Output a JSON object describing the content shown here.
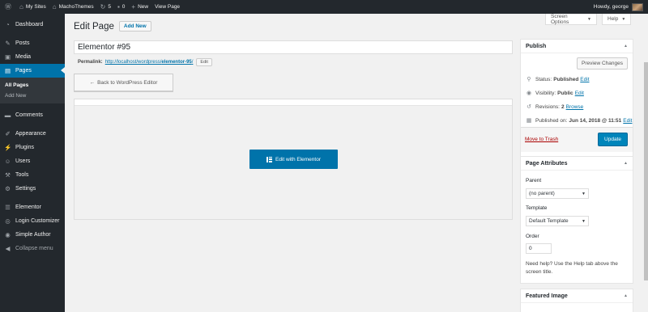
{
  "admin_bar": {
    "my_sites": "My Sites",
    "site_name": "MachoThemes",
    "updates_count": "5",
    "comments_count": "0",
    "new_label": "New",
    "view_page": "View Page",
    "howdy": "Howdy, george"
  },
  "sidebar": {
    "items": [
      {
        "label": "Dashboard",
        "icon": "dashboard-icon"
      },
      {
        "label": "Posts",
        "icon": "pin-icon"
      },
      {
        "label": "Media",
        "icon": "media-icon"
      },
      {
        "label": "Pages",
        "icon": "pages-icon"
      },
      {
        "label": "Comments",
        "icon": "comment-icon"
      },
      {
        "label": "Appearance",
        "icon": "brush-icon"
      },
      {
        "label": "Plugins",
        "icon": "plugin-icon"
      },
      {
        "label": "Users",
        "icon": "users-icon"
      },
      {
        "label": "Tools",
        "icon": "wrench-icon"
      },
      {
        "label": "Settings",
        "icon": "settings-icon"
      },
      {
        "label": "Elementor",
        "icon": "elementor-icon"
      },
      {
        "label": "Login Customizer",
        "icon": "login-icon"
      },
      {
        "label": "Simple Author",
        "icon": "author-icon"
      },
      {
        "label": "Collapse menu",
        "icon": "collapse-icon"
      }
    ],
    "submenu": {
      "all_pages": "All Pages",
      "add_new": "Add New"
    }
  },
  "screen_options": "Screen Options",
  "help": "Help",
  "page": {
    "heading": "Edit Page",
    "add_new": "Add New",
    "title_value": "Elementor #95",
    "permalink_label": "Permalink:",
    "permalink_base": "http://localhost/wordpress/",
    "permalink_slug": "elementor-95",
    "permalink_trail": "/",
    "permalink_edit": "Edit",
    "back_button": "Back to WordPress Editor",
    "elementor_button": "Edit with Elementor"
  },
  "publish": {
    "title": "Publish",
    "preview": "Preview Changes",
    "status_label": "Status:",
    "status_value": "Published",
    "visibility_label": "Visibility:",
    "visibility_value": "Public",
    "revisions_label": "Revisions:",
    "revisions_value": "2",
    "browse": "Browse",
    "published_label": "Published on:",
    "published_value": "Jun 14, 2018 @ 11:51",
    "edit": "Edit",
    "trash": "Move to Trash",
    "update": "Update"
  },
  "attributes": {
    "title": "Page Attributes",
    "parent_label": "Parent",
    "parent_value": "(no parent)",
    "template_label": "Template",
    "template_value": "Default Template",
    "order_label": "Order",
    "order_value": "0",
    "help_text": "Need help? Use the Help tab above the screen title."
  },
  "featured": {
    "title": "Featured Image"
  },
  "colors": {
    "admin_bg": "#23282d",
    "accent": "#0073aa",
    "button_primary": "#0085ba",
    "trash": "#a00"
  }
}
